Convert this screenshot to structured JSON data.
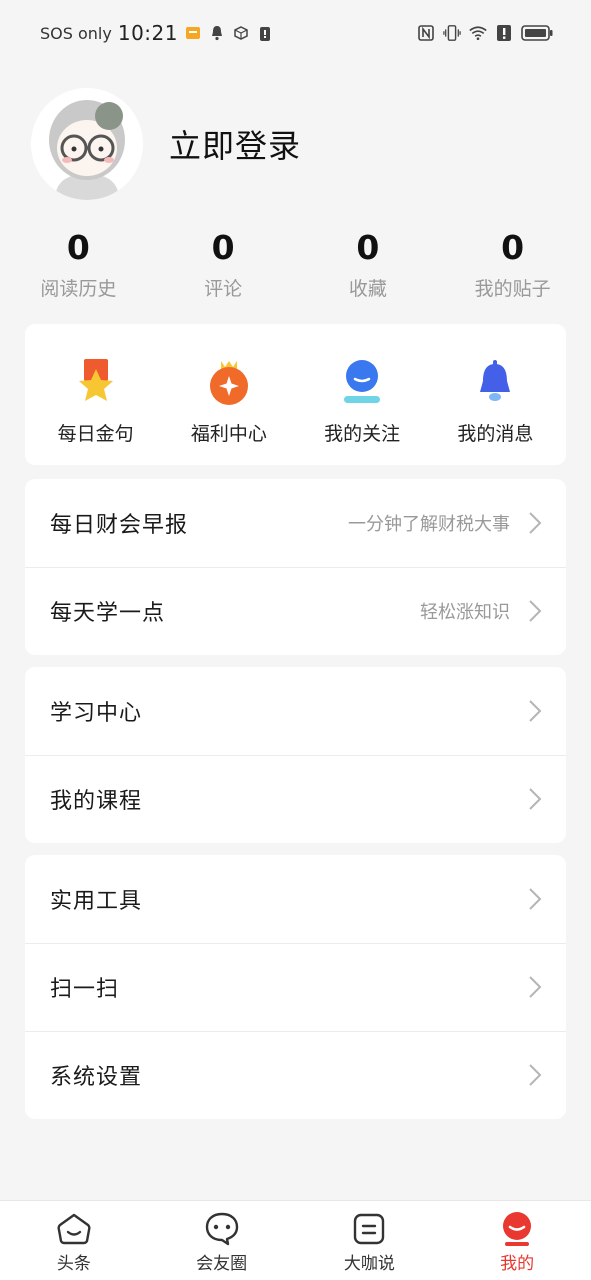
{
  "status_bar": {
    "carrier": "SOS only",
    "time": "10:21",
    "icons": [
      "notification-icon",
      "bell-icon",
      "cube-icon",
      "alert-icon",
      "nfc-icon",
      "vibrate-icon",
      "wifi-icon",
      "warning-icon",
      "battery-icon"
    ]
  },
  "profile": {
    "login_label": "立即登录"
  },
  "stats": [
    {
      "value": "0",
      "label": "阅读历史"
    },
    {
      "value": "0",
      "label": "评论"
    },
    {
      "value": "0",
      "label": "收藏"
    },
    {
      "value": "0",
      "label": "我的贴子"
    }
  ],
  "quick_actions": [
    {
      "label": "每日金句",
      "icon": "star-ribbon-icon",
      "color": "#f7c633"
    },
    {
      "label": "福利中心",
      "icon": "medal-icon",
      "color": "#f06a2a"
    },
    {
      "label": "我的关注",
      "icon": "follow-icon",
      "color": "#3a78ef"
    },
    {
      "label": "我的消息",
      "icon": "bell-icon",
      "color": "#4460e8"
    }
  ],
  "group1": [
    {
      "label": "每日财会早报",
      "hint": "一分钟了解财税大事"
    },
    {
      "label": "每天学一点",
      "hint": "轻松涨知识"
    }
  ],
  "group2": [
    {
      "label": "学习中心"
    },
    {
      "label": "我的课程"
    }
  ],
  "group3": [
    {
      "label": "实用工具"
    },
    {
      "label": "扫一扫"
    },
    {
      "label": "系统设置"
    }
  ],
  "bottom_nav": [
    {
      "label": "头条",
      "icon": "house-smile-icon",
      "active": false
    },
    {
      "label": "会友圈",
      "icon": "chat-bubble-icon",
      "active": false
    },
    {
      "label": "大咖说",
      "icon": "list-doc-icon",
      "active": false
    },
    {
      "label": "我的",
      "icon": "profile-face-icon",
      "active": true
    }
  ],
  "colors": {
    "accent_red": "#e8382f",
    "background": "#f5f5f5",
    "muted_text": "#999999"
  }
}
